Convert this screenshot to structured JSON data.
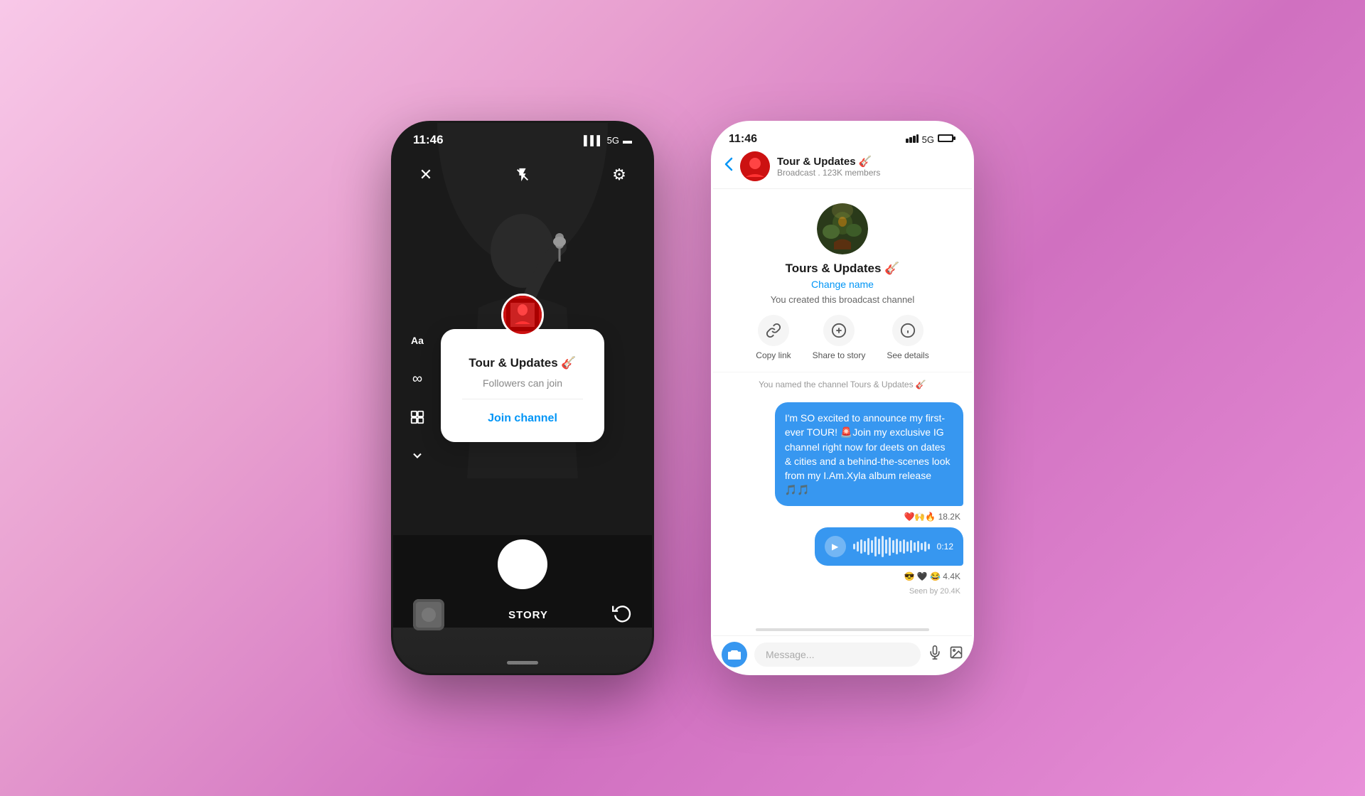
{
  "left_phone": {
    "status": {
      "time": "11:46",
      "signal": "▌▌▌",
      "network": "5G",
      "battery": "🔋"
    },
    "top_controls": {
      "close_icon": "✕",
      "flash_icon": "⚡",
      "settings_icon": "⚙"
    },
    "side_icons": {
      "text_icon": "Aa",
      "filter_icon": "∞",
      "layout_icon": "⊞",
      "more_icon": "∨"
    },
    "channel_popup": {
      "channel_name": "Tour & Updates 🎸",
      "followers_text": "Followers can join",
      "join_btn": "Join channel"
    },
    "bottom": {
      "story_label": "STORY",
      "gallery_placeholder": ""
    },
    "home_indicator": ""
  },
  "right_phone": {
    "status": {
      "time": "11:46",
      "signal": "▌▌▌",
      "network": "5G",
      "battery": "🔋"
    },
    "header": {
      "back_icon": "‹",
      "channel_name": "Tour & Updates 🎸",
      "channel_sub": "Broadcast . 123K members"
    },
    "channel_info": {
      "channel_name": "Tours & Updates 🎸",
      "change_name": "Change name",
      "broadcast_notice": "You created this broadcast channel",
      "copy_link_label": "Copy link",
      "share_story_label": "Share to story",
      "see_details_label": "See details"
    },
    "system_message": "You named the channel Tours & Updates 🎸",
    "messages": [
      {
        "text": "I'm SO excited to announce my first-ever TOUR! 🚨Join my exclusive IG channel right now for deets on dates & cities and a behind-the-scenes look from my I.Am.Xyla album release 🎵🎵",
        "reactions": "❤️🙌🔥 18.2K"
      }
    ],
    "audio_message": {
      "duration": "0:12",
      "reactions": "😎 🖤 😂 4.4K"
    },
    "seen_by": "Seen by 20.4K",
    "input_placeholder": "Message...",
    "copy_icon": "🔗",
    "share_icon": "⊕",
    "info_icon": "ℹ"
  }
}
